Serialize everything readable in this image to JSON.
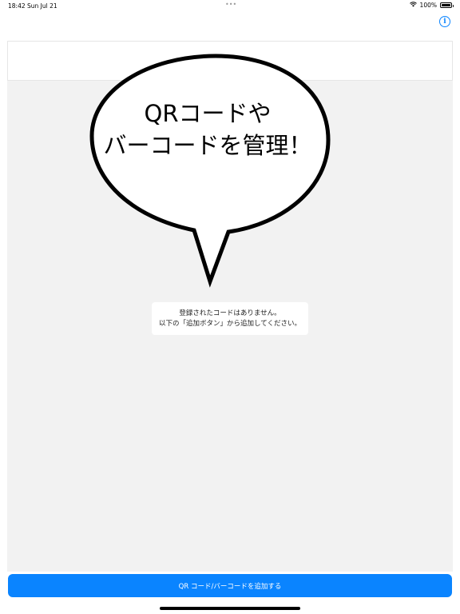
{
  "status_bar": {
    "time": "18:42",
    "date": "Sun Jul 21",
    "multitasking_dots": "•••",
    "battery_percent": "100%",
    "battery_level": 1.0,
    "icons": [
      "wifi-icon",
      "battery-icon"
    ]
  },
  "header": {
    "info_icon_glyph": "i"
  },
  "bubble": {
    "line1": "QRコードや",
    "line2": "バーコードを管理！"
  },
  "empty_state": {
    "line1": "登録されたコードはありません。",
    "line2": "以下の「追加ボタン」から追加してください。"
  },
  "add_button": {
    "label": "QR コード/バーコードを追加する"
  },
  "colors": {
    "accent": "#0a84ff",
    "content_background": "#f2f2f2"
  }
}
